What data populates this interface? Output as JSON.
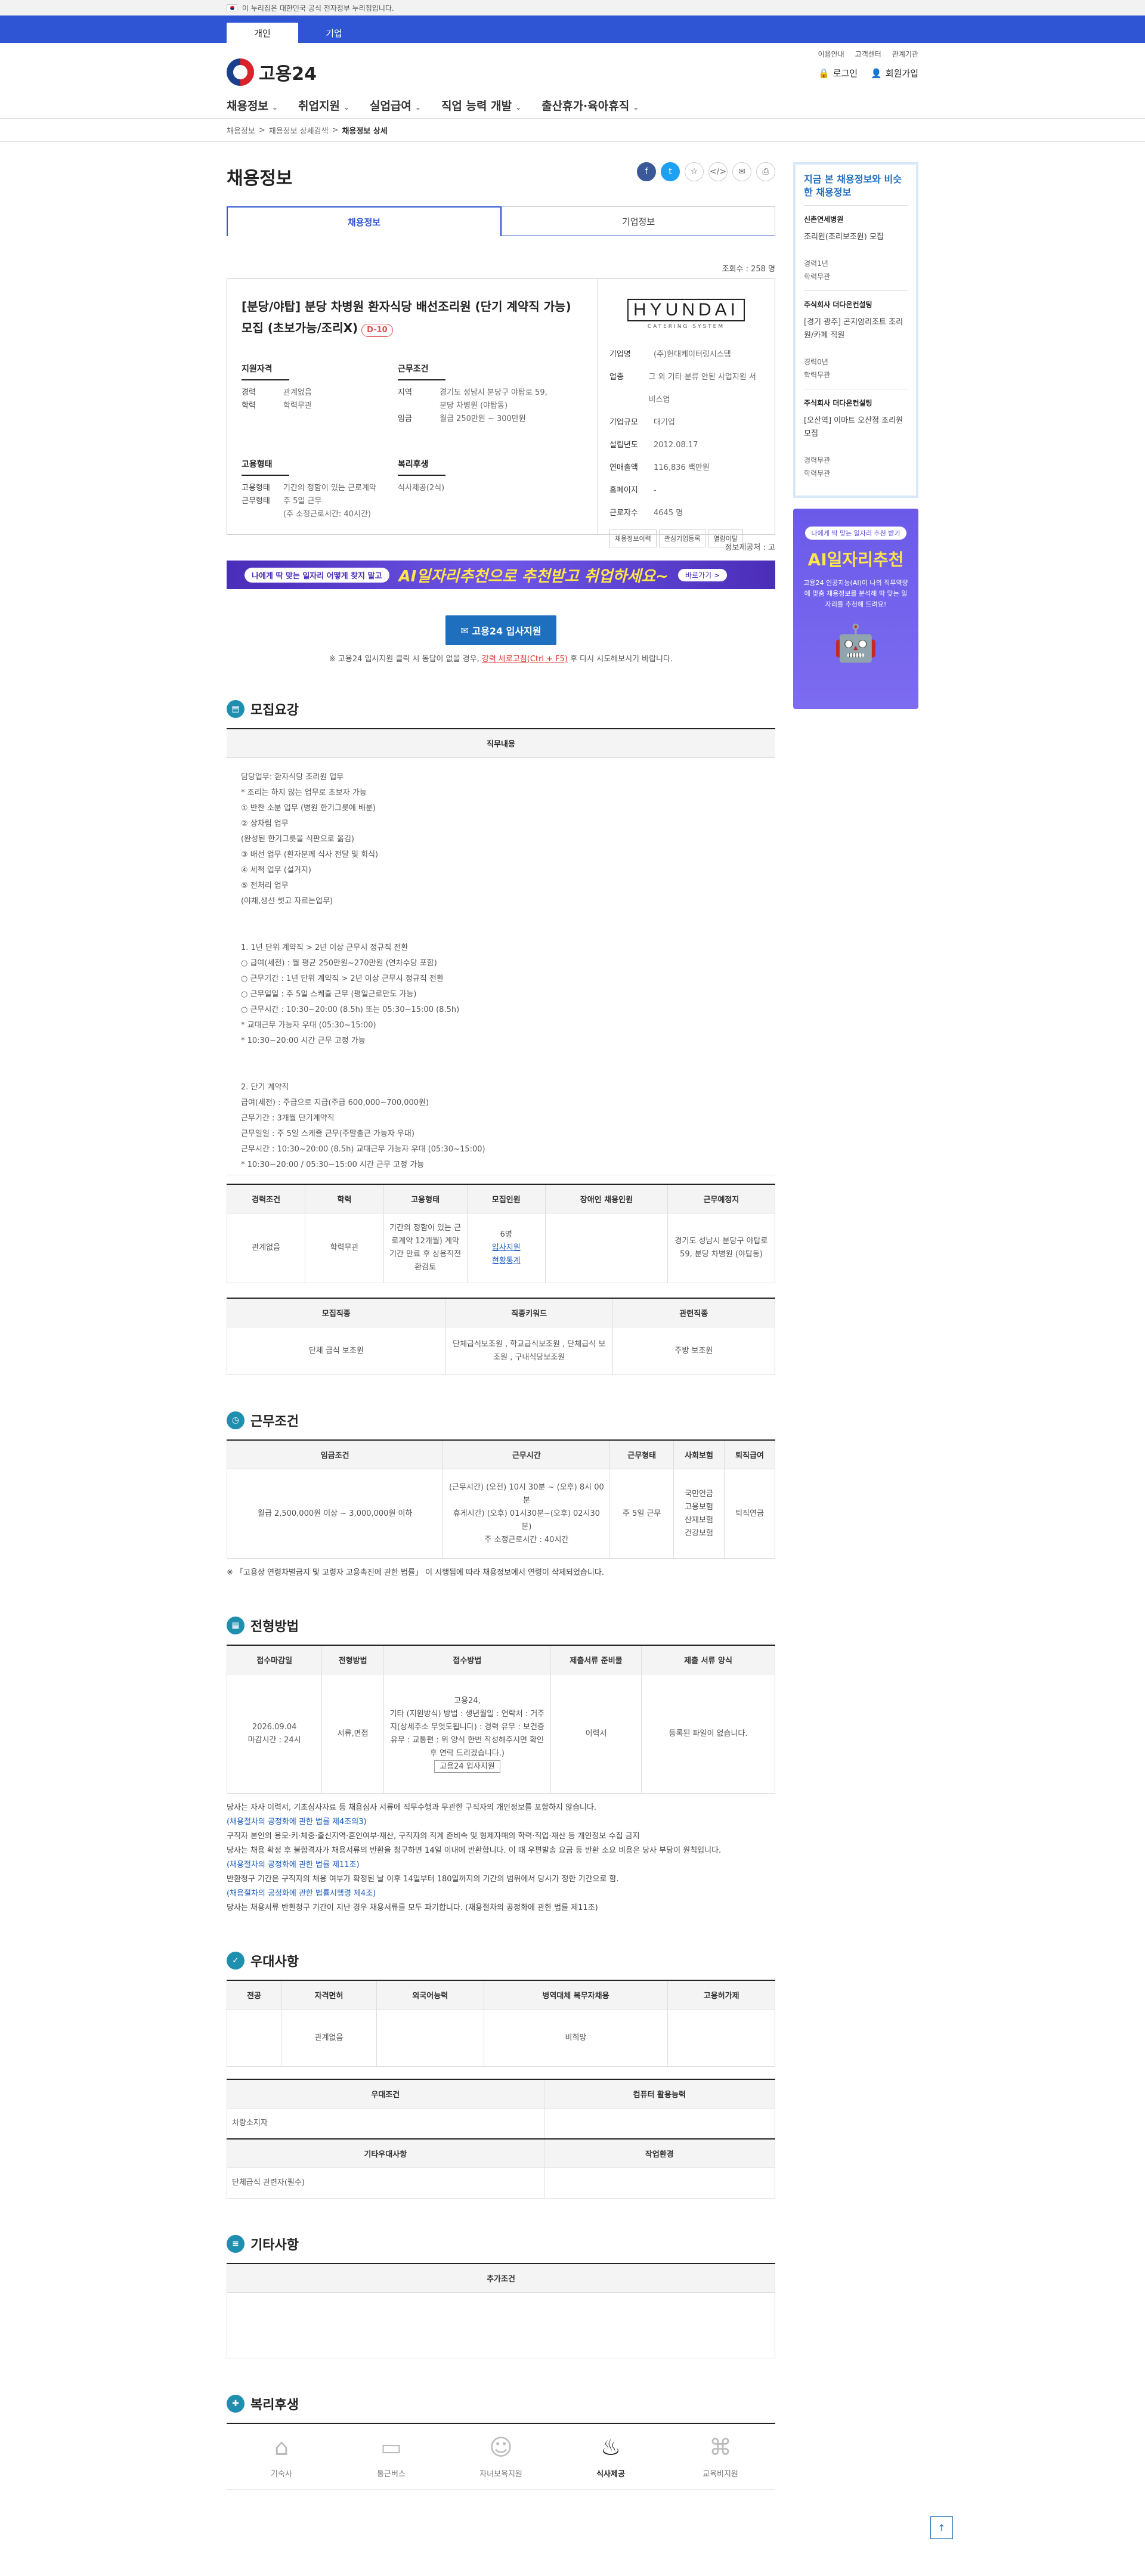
{
  "gov_banner": "이 누리집은 대한민국 공식 전자정부 누리집입니다.",
  "audience_tabs": [
    "개인",
    "기업"
  ],
  "header": {
    "logo": "고용24",
    "util": [
      "이용안내",
      "고객센터",
      "관계기관"
    ],
    "login": "로그인",
    "join": "회원가입"
  },
  "gnb": [
    "채용정보",
    "취업지원",
    "실업급여",
    "직업 능력 개발",
    "출산휴가·육아휴직"
  ],
  "breadcrumb": [
    "채용정보",
    "채용정보 상세검색",
    "채용정보 상세"
  ],
  "page_title": "채용정보",
  "tabs": [
    "채용정보",
    "기업정보"
  ],
  "views": "조회수 : 258 명",
  "job": {
    "title": "[분당/야탑] 분당 차병원 환자식당 배선조리원 (단기 계약직 가능) 모집 (초보가능/조리X)",
    "dday": "D-10",
    "qual_title": "지원자격",
    "qual": [
      [
        "경력",
        "관계없음"
      ],
      [
        "학력",
        "학력무관"
      ]
    ],
    "cond_title": "근무조건",
    "cond": [
      [
        "지역",
        "경기도 성남시 분당구 야탑로 59, 분당 차병원 (야탑동)"
      ],
      [
        "임금",
        "월급 250만원 ~ 300만원"
      ]
    ],
    "emp_title": "고용형태",
    "emp": [
      [
        "고용형태",
        "기간의 정함이 있는 근로계약"
      ],
      [
        "근무형태",
        "주 5일 근무"
      ]
    ],
    "emp_note": "(주 소정근로시간: 40시간)",
    "welfare_title": "복리후생",
    "welfare": "식사제공(2식)"
  },
  "company": {
    "logo_word": "HYUNDAI",
    "logo_sub": "CATERING SYSTEM",
    "rows": [
      [
        "기업명",
        "(주)현대케이터링시스템"
      ],
      [
        "업종",
        "그 외 기타 분류 안된 사업지원 서비스업"
      ],
      [
        "기업규모",
        "대기업"
      ],
      [
        "설립년도",
        "2012.08.17"
      ],
      [
        "연매출액",
        "116,836 백만원"
      ],
      [
        "홈페이지",
        "-"
      ],
      [
        "근로자수",
        "4645 명"
      ]
    ],
    "buttons": [
      "채용정보이력",
      "관심기업등록",
      "열람이탈"
    ]
  },
  "updated": "정보제공처 : 고",
  "ai_banner": {
    "pill": "나에게 딱 맞는 일자리 어떻게 찾지 말고",
    "big": "AI일자리추천으로 추천받고 취업하세요~",
    "more": "바로가기 >"
  },
  "apply": {
    "label": "고용24 입사지원",
    "note_pre": "※ 고용24 입사지원 클릭 시 동답이 없을 경우, ",
    "note_link": "강력 새로고침(Ctrl + F5)",
    "note_post": " 후 다시 시도해보시기 바랍니다."
  },
  "sections": {
    "recruit": "모집요강",
    "work": "근무조건",
    "process": "전형방법",
    "pref": "우대사항",
    "etc": "기타사항",
    "welfare": "복리후생"
  },
  "duty": {
    "head": "직무내용",
    "body": "담당업무: 환자식당 조리원 업무\n* 조리는 하지 않는 업무로 초보자 가능\n① 반찬 소분 업무 (병원 한기그릇에 배분)\n② 상차림 업무\n(완성된 한기그릇을 식판으로 옮김)\n③ 배선 업무 (환자분께 식사 전달 및 회식)\n④ 세척 업무 (설거지)\n⑤ 전처리 업무\n(야채,생선 썻고 자르는업무)\n\n\n1. 1년 단위 계약직 > 2년 이상 근무시 정규직 전환\n○ 급여(세전) : 월 평균 250만원~270만원 (연차수당 포함)\n○ 근무기간 : 1년 단위 계약직 > 2년 이상 근무시 정규직 전환\n○ 근무일일 : 주 5일 스케쥴 근무 (평일근로만도 가능)\n○ 근무시간 : 10:30~20:00 (8.5h) 또는 05:30~15:00 (8.5h)\n* 교대근무 가능자 우대 (05:30~15:00)\n* 10:30~20:00 시간 근무 고정 가능\n\n\n2. 단기 계약직\n급여(세전) : 주급으로 지급(주급 600,000~700,000원)\n근무기간 : 3개월 단기계약직\n근무일일 : 주 5일 스케쥴 근무(주말출근 가능자 우대)\n근무시간 : 10:30~20:00 (8.5h) 교대근무 가능자 우대 (05:30~15:00)\n* 10:30~20:00 / 05:30~15:00 시간 근무 고정 가능"
  },
  "recruit_table": {
    "headers": [
      "경력조건",
      "학력",
      "고용형태",
      "모집인원",
      "장애인 채용인원",
      "근무예정지"
    ],
    "row": [
      "관계없음",
      "학력무관",
      "기간의 정함이 있는 근로계약 12개월) 계약기간 만료 후 상용직전환검토",
      "6명",
      "",
      "경기도 성남시 분당구 야탑로 59, 분당 차병원 (야탑동)"
    ],
    "links": [
      "입사지원",
      "현황통계"
    ]
  },
  "job_table": {
    "headers": [
      "모집직종",
      "직종키워드",
      "관련직종"
    ],
    "row": [
      "단체 급식 보조원",
      "단체급식보조원 , 학교급식보조원 , 단체급식 보조원 , 구내식당보조원",
      "주방 보조원"
    ]
  },
  "work_table": {
    "headers": [
      "임금조건",
      "근무시간",
      "근무형태",
      "사회보험",
      "퇴직급여"
    ],
    "row": [
      "월급 2,500,000원 이상 ~ 3,000,000원 이하",
      "(근무시간) (오전) 10시 30분 ~ (오후) 8시 00분\n휴게시간) (오후) 01시30분~(오후) 02시30분)",
      "주 5일 근무",
      "국민연금\n고용보험\n산재보험\n건강보험",
      "퇴직연금"
    ],
    "weekly": "주 소정근로시간 : 40시간"
  },
  "work_note": "※ 「고용상 연령차별금지 및 고령자 고용촉진에 관한 법률」 이 시행됨에 따라 채용정보에서 연령이 삭제되었습니다.",
  "process_table": {
    "headers": [
      "접수마감일",
      "전형방법",
      "접수방법",
      "제출서류 준비물",
      "제출 서류 양식"
    ],
    "row": [
      "2026.09.04\n마감시간 : 24시",
      "서류,면접",
      "고용24,\n기타 (지원방식) 방법 : 생년월일 : 연락처 : 거주지(상세주소 무엇도됩니다) : 경력 유무 : 보건증 유무 : 교통편 : 위 양식 한번 작성해주시면 확인 후 연락 드리겠습니다.)",
      "이력서",
      "등록된 파일이 없습니다."
    ],
    "btn": "고용24 입사지원"
  },
  "process_notes": [
    "당사는 자사 이력서, 기초심사자료 등 채용심사 서류에 직무수행과 무관한 구직자의 개인정보를 포함하지 않습니다.",
    "(채용절차의 공정화에 관한 법률 제4조의3)",
    "구직자 본인의 용모·키·체중·출신지역·혼인여부·재산, 구직자의 직계 존비속 및 형제자매의 학력·직업·재산 등 개인정보 수집 금지",
    "당사는 채용 확정 후 불합격자가 채용서류의 반환을 청구하면 14일 이내에 반환합니다. 이 때 우편발송 요금 등 반환 소요 비용은 당사 부담이 원칙입니다.",
    "(채용절차의 공정화에 관한 법률 제11조)",
    "반환청구 기간은 구직자의 채용 여부가 확정된 날 이후 14일부터 180일까지의 기간의 범위에서 당사가 정한 기간으로 함.",
    "(채용절차의 공정화에 관한 법률시행령 제4조)",
    "당사는 채용서류 반환청구 기간이 지난 경우 채용서류를 모두 파기합니다. (채용절차의 공정화에 관한 법률 제11조)"
  ],
  "pref_table": {
    "headers": [
      "전공",
      "자격면허",
      "외국어능력",
      "병역대체 복무자채용",
      "고용허가제"
    ],
    "row": [
      "",
      "관계없음",
      "",
      "비희망",
      ""
    ]
  },
  "pref_table2": {
    "h1": "우대조건",
    "h2": "컴퓨터 활용능력",
    "v1": "차량소지자",
    "v2": "",
    "h3": "기타우대사항",
    "h4": "작업환경",
    "v3": "단체급식 관련자(필수)",
    "v4": ""
  },
  "etc_table": {
    "head": "추가조건",
    "body": ""
  },
  "welfare_items": [
    "기숙사",
    "통근버스",
    "자녀보육지원",
    "식사제공",
    "교육비지원"
  ],
  "aside": {
    "title": "지금 본 채용정보와 비슷한 채용정보",
    "items": [
      {
        "co": "신촌연세병원",
        "title": "조리원(조리보조원) 모집",
        "exp": "경력1년",
        "edu": "학력무관"
      },
      {
        "co": "주식회사 더다온컨설팅",
        "title": "[경기 광주] 곤지암리조트 조리원/카페 직원",
        "exp": "경력0년",
        "edu": "학력무관"
      },
      {
        "co": "주식회사 더다온컨설팅",
        "title": "[오산역] 이마트 오산점 조리원 모집",
        "exp": "경력무관",
        "edu": "학력무관"
      }
    ],
    "ai_pill": "나에게 딱 맞는 일자리 추천 받기",
    "ai_big": "AI일자리추천",
    "ai_text": "고용24 인공지능(AI)이 나의 직무역량에 맞춤 채용정보를 분석해 딱 맞는 일자리를 추천해 드려요!"
  }
}
